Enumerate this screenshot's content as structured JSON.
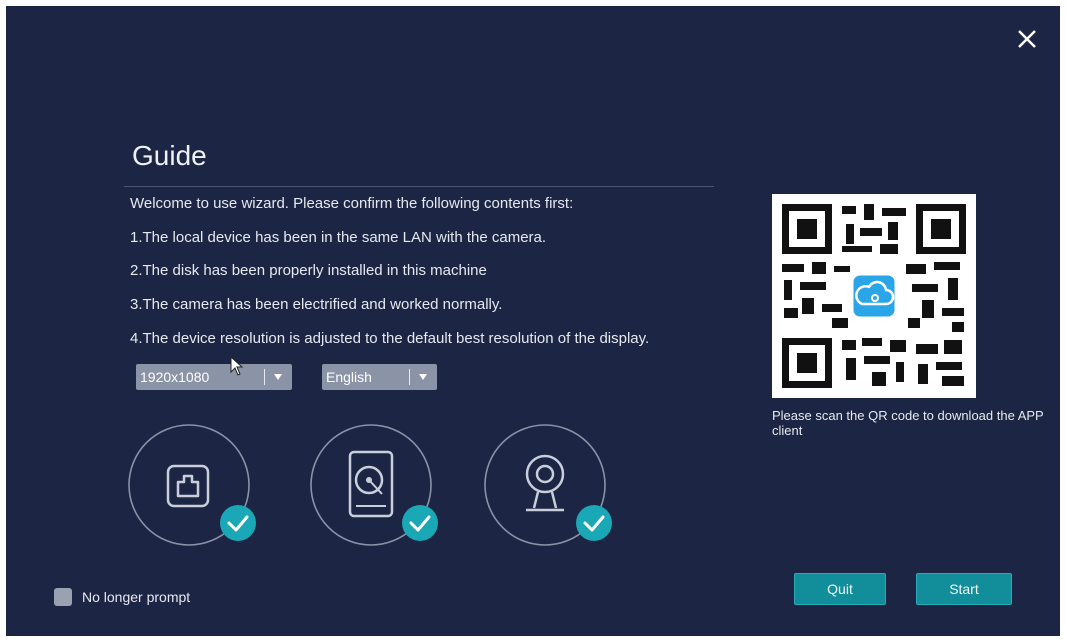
{
  "dialog": {
    "title": "Guide",
    "intro": "Welcome to use wizard. Please confirm the following contents first:",
    "items": [
      "1.The local device has been in the same LAN with the camera.",
      "2.The disk has been properly installed in this machine",
      "3.The camera has been electrified and worked normally.",
      "4.The device resolution is adjusted to the default best resolution of the display."
    ],
    "resolution_select": {
      "value": "1920x1080"
    },
    "language_select": {
      "value": "English"
    },
    "status_icons": [
      "network-icon",
      "hard-disk-icon",
      "camera-icon"
    ],
    "qr_caption": "Please scan the QR code to download the APP client",
    "no_prompt_label": "No longer prompt",
    "quit_label": "Quit",
    "start_label": "Start"
  },
  "colors": {
    "background": "#1c2544",
    "accent": "#128d9a",
    "check": "#1aa7b6",
    "select": "#8b93a6"
  }
}
